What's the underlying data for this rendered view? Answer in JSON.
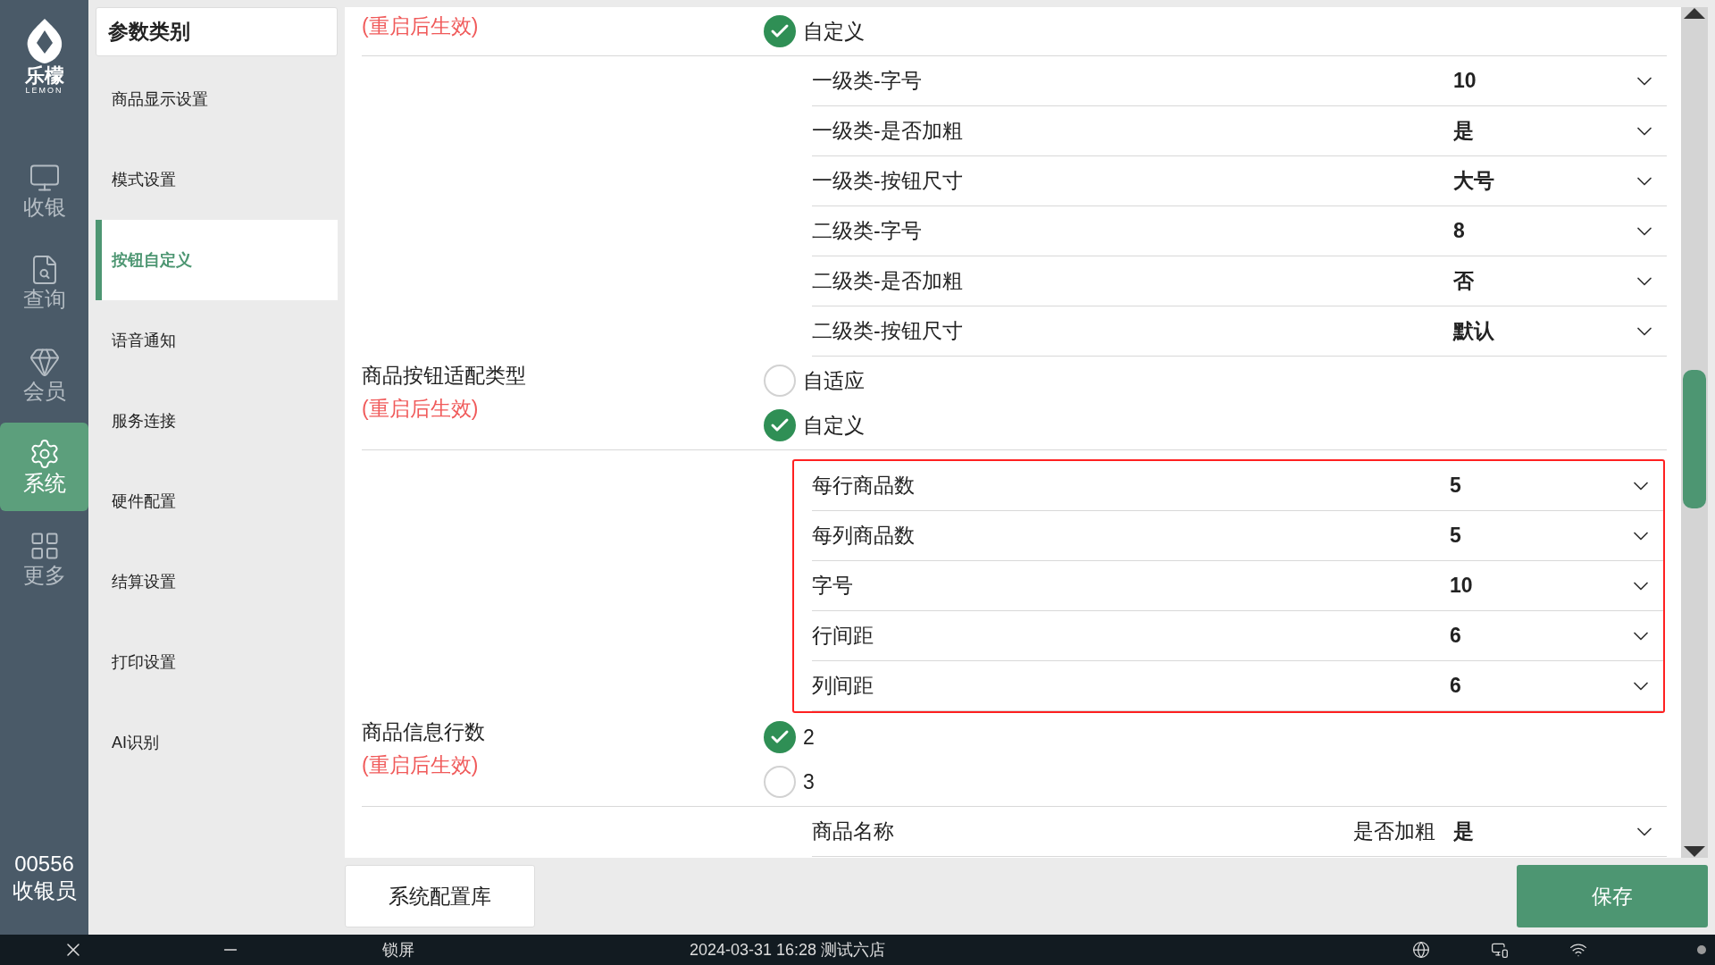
{
  "app": {
    "logo_name": "乐檬",
    "logo_subtitle": "LEMON"
  },
  "nav": [
    {
      "label": "收银",
      "selected": false
    },
    {
      "label": "查询",
      "selected": false
    },
    {
      "label": "会员",
      "selected": false
    },
    {
      "label": "系统",
      "selected": true
    },
    {
      "label": "更多",
      "selected": false
    }
  ],
  "user": {
    "id": "00556",
    "role": "收银员"
  },
  "categories": {
    "title": "参数类别",
    "items": [
      {
        "label": "商品显示设置",
        "selected": false
      },
      {
        "label": "模式设置",
        "selected": false
      },
      {
        "label": "按钮自定义",
        "selected": true
      },
      {
        "label": "语音通知",
        "selected": false
      },
      {
        "label": "服务连接",
        "selected": false
      },
      {
        "label": "硬件配置",
        "selected": false
      },
      {
        "label": "结算设置",
        "selected": false
      },
      {
        "label": "打印设置",
        "selected": false
      },
      {
        "label": "AI识别",
        "selected": false
      }
    ]
  },
  "groups": [
    {
      "note": "(重启后生效)",
      "highlighted": false,
      "options": [
        {
          "label": "自定义",
          "selected": true
        }
      ],
      "settings": [
        {
          "label": "一级类-字号",
          "value": "10"
        },
        {
          "label": "一级类-是否加粗",
          "value": "是"
        },
        {
          "label": "一级类-按钮尺寸",
          "value": "大号"
        },
        {
          "label": "二级类-字号",
          "value": "8"
        },
        {
          "label": "二级类-是否加粗",
          "value": "否"
        },
        {
          "label": "二级类-按钮尺寸",
          "value": "默认"
        }
      ]
    },
    {
      "label": "商品按钮适配类型",
      "note": "(重启后生效)",
      "options": [
        {
          "label": "自适应",
          "selected": false
        },
        {
          "label": "自定义",
          "selected": true
        }
      ]
    },
    {
      "highlighted": true,
      "settings": [
        {
          "label": "每行商品数",
          "value": "5"
        },
        {
          "label": "每列商品数",
          "value": "5"
        },
        {
          "label": "字号",
          "value": "10"
        },
        {
          "label": "行间距",
          "value": "6"
        },
        {
          "label": "列间距",
          "value": "6"
        }
      ]
    },
    {
      "label": "商品信息行数",
      "note": "(重启后生效)",
      "options": [
        {
          "label": "2",
          "selected": true
        },
        {
          "label": "3",
          "selected": false
        }
      ]
    },
    {
      "highlighted": false,
      "settings": [
        {
          "label": "商品名称",
          "sublabel": "是否加粗",
          "value": "是"
        }
      ]
    }
  ],
  "buttons": {
    "config_library": "系统配置库",
    "save": "保存"
  },
  "taskbar": {
    "lock": "锁屏",
    "status": "2024-03-31 16:28 测试六店"
  }
}
